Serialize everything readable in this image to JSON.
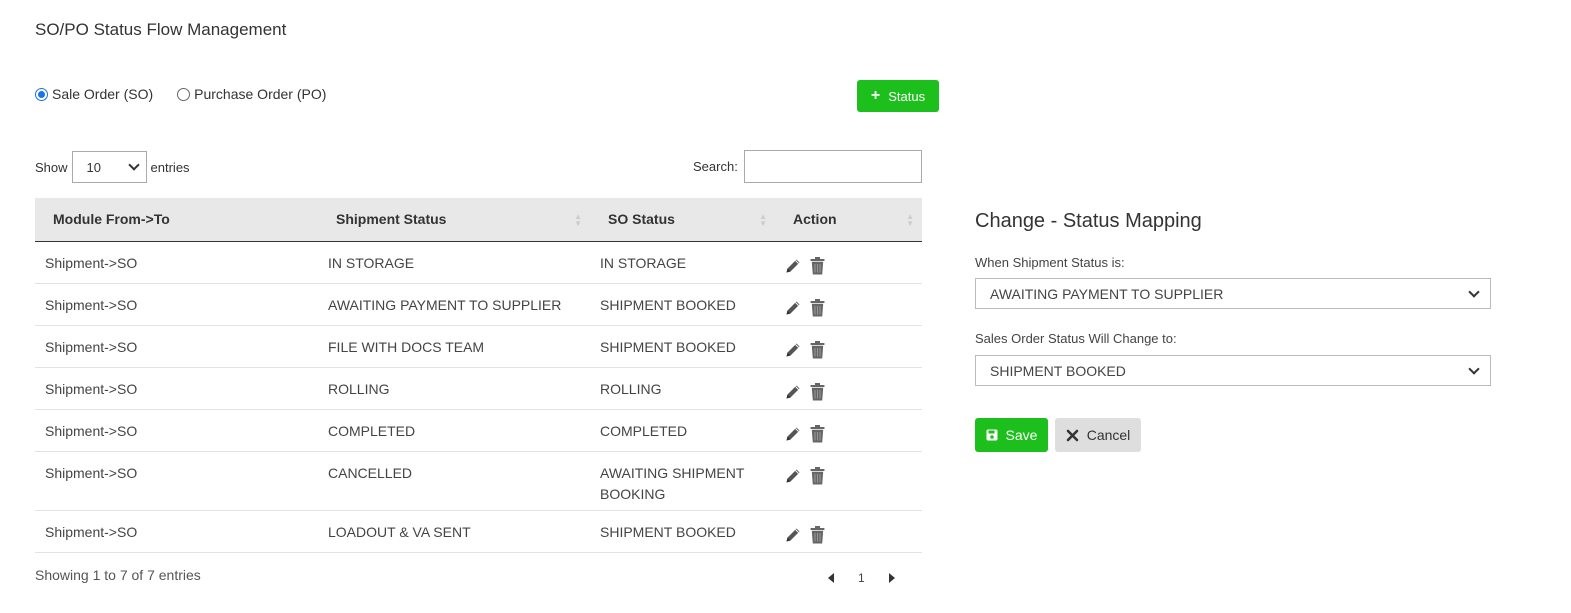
{
  "page": {
    "title": "SO/PO Status Flow Management"
  },
  "order_type": {
    "options": [
      {
        "label": "Sale Order (SO)",
        "checked": true
      },
      {
        "label": "Purchase Order (PO)",
        "checked": false
      }
    ]
  },
  "toolbar": {
    "add_status_label": "Status",
    "add_icon": "plus-icon"
  },
  "table_controls": {
    "show_label": "Show",
    "entries_value": "10",
    "entries_label": "entries",
    "search_label": "Search:",
    "search_value": ""
  },
  "table": {
    "columns": [
      "Module From->To",
      "Shipment Status",
      "SO Status",
      "Action"
    ],
    "rows": [
      {
        "module": "Shipment->SO",
        "shipment_status": "IN STORAGE",
        "so_status": "IN STORAGE"
      },
      {
        "module": "Shipment->SO",
        "shipment_status": "AWAITING PAYMENT TO SUPPLIER",
        "so_status": "SHIPMENT BOOKED"
      },
      {
        "module": "Shipment->SO",
        "shipment_status": "FILE WITH DOCS TEAM",
        "so_status": "SHIPMENT BOOKED"
      },
      {
        "module": "Shipment->SO",
        "shipment_status": "ROLLING",
        "so_status": "ROLLING"
      },
      {
        "module": "Shipment->SO",
        "shipment_status": "COMPLETED",
        "so_status": "COMPLETED"
      },
      {
        "module": "Shipment->SO",
        "shipment_status": "CANCELLED",
        "so_status": "AWAITING SHIPMENT BOOKING"
      },
      {
        "module": "Shipment->SO",
        "shipment_status": "LOADOUT & VA SENT",
        "so_status": "SHIPMENT BOOKED"
      }
    ],
    "action_icons": [
      "pencil-icon",
      "trash-icon"
    ]
  },
  "pagination": {
    "info": "Showing 1 to 7 of 7 entries",
    "current_page": "1"
  },
  "mapping_panel": {
    "title": "Change - Status Mapping",
    "shipment_label": "When Shipment Status is:",
    "shipment_value": "AWAITING PAYMENT TO SUPPLIER",
    "so_label": "Sales Order Status Will Change to:",
    "so_value": "SHIPMENT BOOKED",
    "save_label": "Save",
    "cancel_label": "Cancel"
  },
  "colors": {
    "primary_green": "#1cbf1c",
    "header_gray": "#e8e8e8",
    "cancel_gray": "#dedede",
    "radio_blue": "#1a73e8"
  }
}
